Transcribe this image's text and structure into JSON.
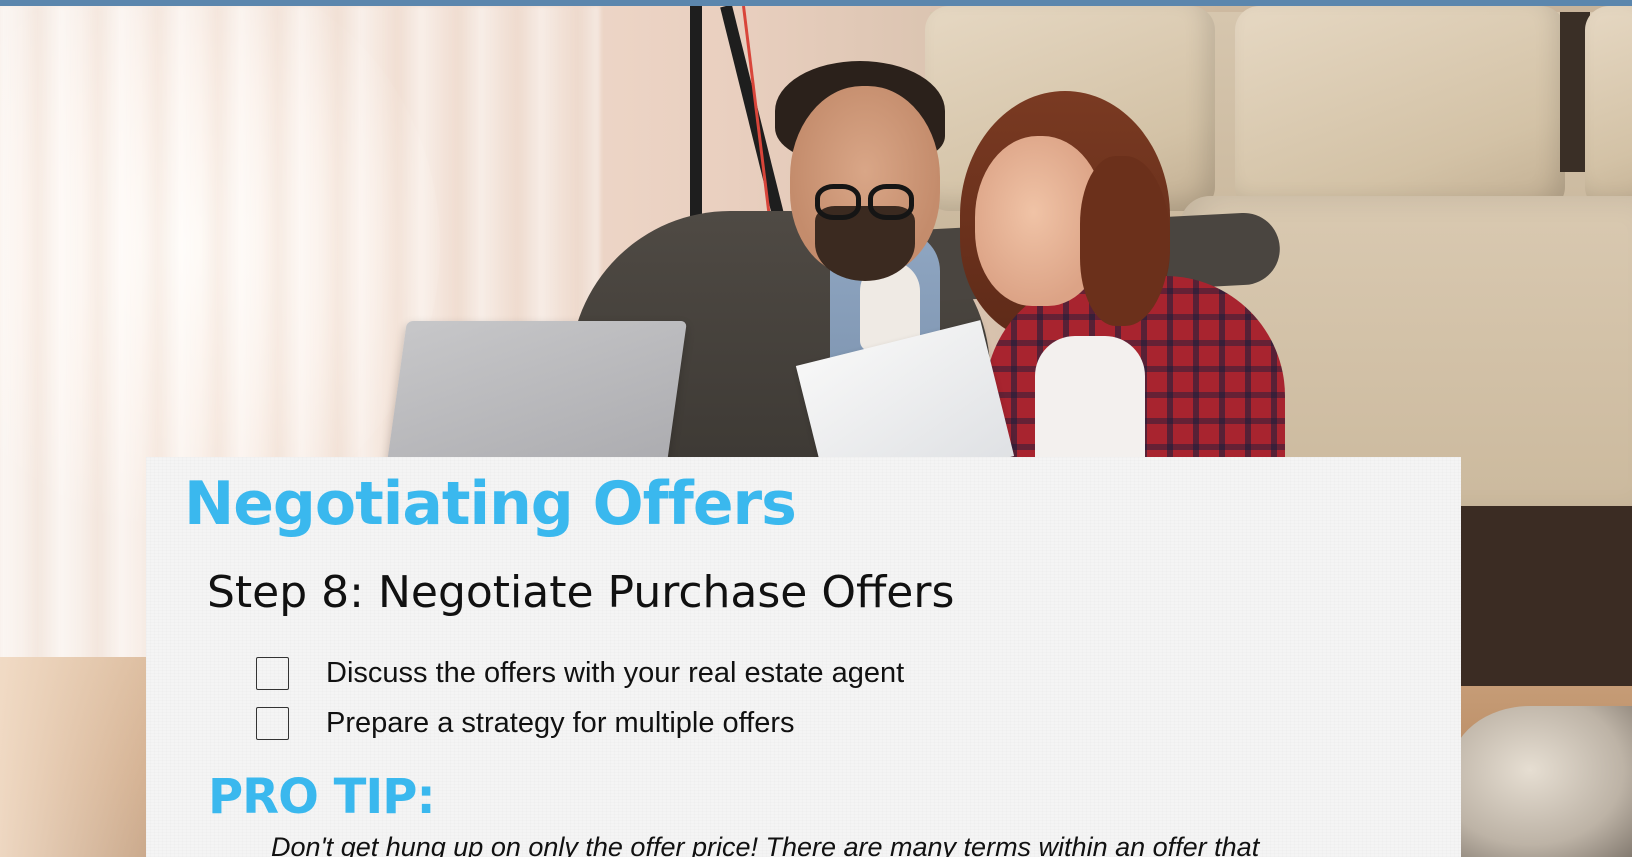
{
  "document": {
    "title": "Negotiating Offers",
    "step_heading": "Step 8: Negotiate Purchase Offers",
    "checklist": [
      {
        "label": "Discuss the offers with your real estate agent",
        "checked": false
      },
      {
        "label": "Prepare a strategy for multiple offers",
        "checked": false
      }
    ],
    "pro_tip_label": "PRO TIP:",
    "pro_tip_text": "Don't get hung up on only the offer price! There are many terms within an offer that"
  },
  "colors": {
    "accent_blue": "#3ab8ee",
    "top_bar": "#5b86ad",
    "card_background": "#f4f4f4",
    "text": "#111111"
  },
  "icons": {
    "checkbox": "empty-checkbox-icon"
  }
}
